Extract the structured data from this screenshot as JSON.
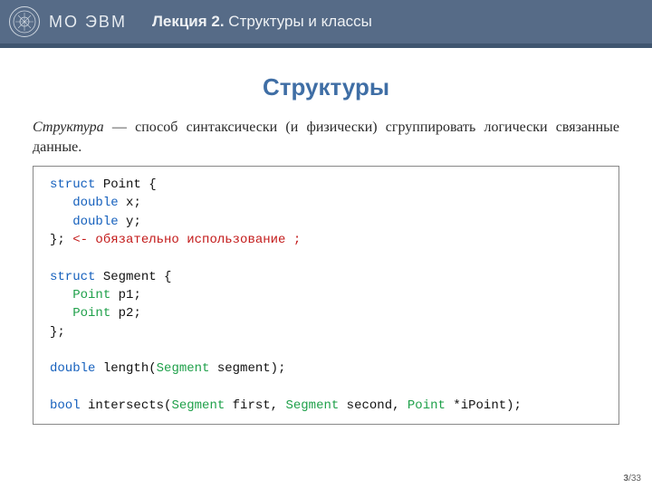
{
  "header": {
    "brand": "МО ЭВМ",
    "lecture_prefix": "Лекция 2.",
    "lecture_title": "Структуры и классы"
  },
  "slide": {
    "title": "Структуры",
    "definition_term": "Структура",
    "definition_rest": " — способ синтаксически (и физически) сгруппировать логически связанные данные."
  },
  "code": {
    "l1_kw": "struct",
    "l1_rest": " Point {",
    "l2_kw": "double",
    "l2_rest": " x;",
    "l3_kw": "double",
    "l3_rest": " y;",
    "l4_close": "}; ",
    "l4_cmt": "<- обязательно использование ;",
    "l6_kw": "struct",
    "l6_rest": " Segment {",
    "l7_ty": "Point",
    "l7_rest": " p1;",
    "l8_ty": "Point",
    "l8_rest": " p2;",
    "l9_close": "};",
    "l11_kw": "double",
    "l11_pre": " length(",
    "l11_ty": "Segment",
    "l11_post": " segment);",
    "l13_kw": "bool",
    "l13_pre": " intersects(",
    "l13_ty1": "Segment",
    "l13_mid1": " first, ",
    "l13_ty2": "Segment",
    "l13_mid2": " second, ",
    "l13_ty3": "Point",
    "l13_post": " *iPoint);"
  },
  "pager": {
    "current": "3",
    "sep": "/",
    "total": "33"
  }
}
